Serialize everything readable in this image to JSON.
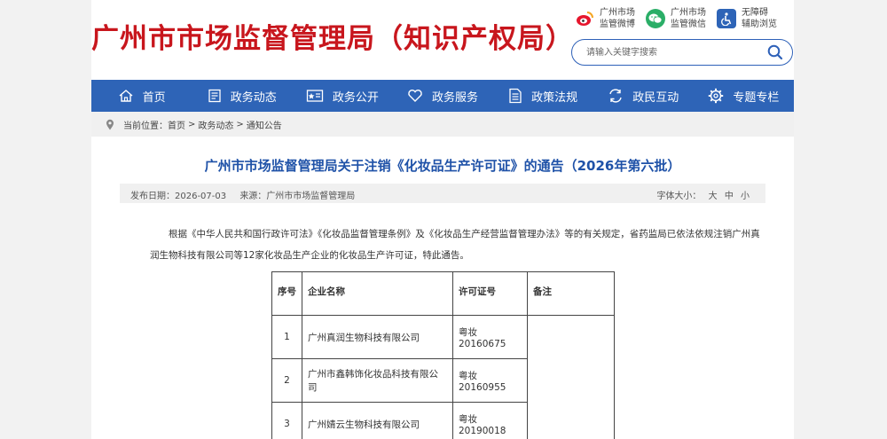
{
  "header": {
    "site_title": "广州市市场监督管理局（知识产权局）",
    "links": [
      {
        "line1": "广州市场",
        "line2": "监管微博",
        "icon": "weibo-icon",
        "color": "#e6162d"
      },
      {
        "line1": "广州市场",
        "line2": "监管微信",
        "icon": "wechat-icon",
        "color": "#2aae67"
      },
      {
        "line1": "无障碍",
        "line2": "辅助浏览",
        "icon": "accessibility-icon",
        "color": "#2e64b7"
      }
    ],
    "search_placeholder": "请输入关键字搜索"
  },
  "nav": {
    "items": [
      {
        "label": "首页",
        "icon": "home-icon"
      },
      {
        "label": "政务动态",
        "icon": "news-icon"
      },
      {
        "label": "政务公开",
        "icon": "disclosure-icon"
      },
      {
        "label": "政务服务",
        "icon": "heart-icon"
      },
      {
        "label": "政策法规",
        "icon": "document-icon"
      },
      {
        "label": "政民互动",
        "icon": "interaction-icon"
      },
      {
        "label": "专题专栏",
        "icon": "gear-icon"
      }
    ]
  },
  "breadcrumb": {
    "prefix": "当前位置：",
    "items": [
      "首页",
      "政务动态",
      "通知公告"
    ],
    "separator": ">"
  },
  "article": {
    "title": "广州市市场监督管理局关于注销《化妆品生产许可证》的通告（2026年第六批）",
    "meta": {
      "date_label": "发布日期：",
      "date": "2026-07-03",
      "source_label": "来源：",
      "source": "广州市市场监督管理局",
      "font_size_label": "字体大小：",
      "font_sizes": [
        "大",
        "中",
        "小"
      ]
    },
    "body": "根据《中华人民共和国行政许可法》《化妆品监督管理条例》及《化妆品生产经营监督管理办法》等的有关规定，省药监局已依法依规注销广州真润生物科技有限公司等12家化妆品生产企业的化妆品生产许可证，特此通告。",
    "table": {
      "headers": [
        "序号",
        "企业名称",
        "许可证号",
        "备注"
      ],
      "rows": [
        {
          "no": "1",
          "name": "广州真润生物科技有限公司",
          "license": "粤妆20160675"
        },
        {
          "no": "2",
          "name": "广州市鑫韩饰化妆品科技有限公司",
          "license": "粤妆20160955"
        },
        {
          "no": "3",
          "name": "广州婧云生物科技有限公司",
          "license": "粤妆20190018"
        }
      ]
    }
  },
  "colors": {
    "brand_red": "#c8161d",
    "nav_blue": "#2e64b7",
    "title_blue": "#1f52a8"
  }
}
